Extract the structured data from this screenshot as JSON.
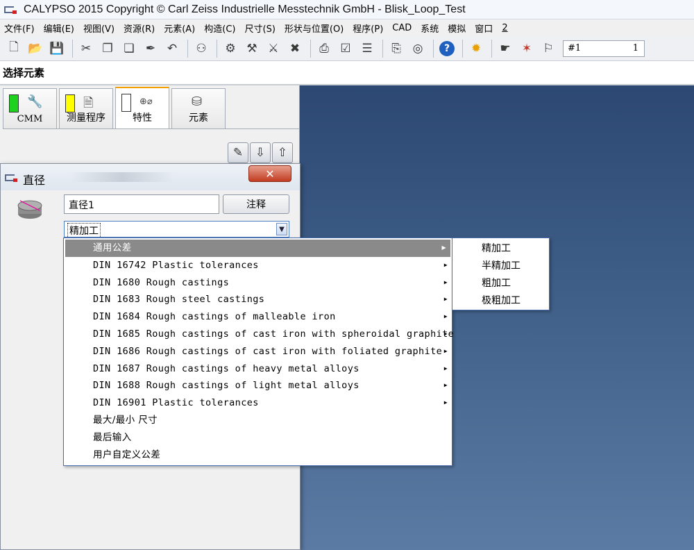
{
  "window": {
    "title": "CALYPSO 2015 Copyright © Carl Zeiss Industrielle Messtechnik GmbH - Blisk_Loop_Test"
  },
  "menu": [
    "文件(F)",
    "编辑(E)",
    "视图(V)",
    "资源(R)",
    "元素(A)",
    "构造(C)",
    "尺寸(S)",
    "形状与位置(O)",
    "程序(P)",
    "CAD",
    "系统",
    "模拟",
    "窗口",
    "2"
  ],
  "toolbar": {
    "icons": [
      "new-file-icon",
      "open-folder-icon",
      "save-icon",
      "cut-icon",
      "copy-icon",
      "paste-icon",
      "brush-icon",
      "undo-icon",
      "binoculars-icon",
      "probe-icon",
      "probe-2-icon",
      "tools-icon",
      "wrench-icon",
      "print-icon",
      "trash-icon",
      "document-icon",
      "clipboard-icon",
      "dial-icon",
      "help-icon",
      "sun-icon",
      "hand-icon",
      "star-icon",
      "run-icon"
    ],
    "field_label": "#1",
    "field_value": "1"
  },
  "section": {
    "title": "选择元素"
  },
  "tabs": [
    {
      "label": "CMM",
      "status_color": "#1fd11f",
      "icon": "wrench-icon"
    },
    {
      "label": "测量程序",
      "status_color": "#ffff00",
      "icon": "document-icon"
    },
    {
      "label": "特性",
      "status_color": "#ffffff",
      "icon": "characteristic-icon"
    },
    {
      "label": "元素",
      "status_color": "",
      "icon": "cylinder-icon"
    }
  ],
  "dialog": {
    "title": "直径",
    "name_value": "直径1",
    "note_button": "注释",
    "tolerance_selected": "精加工"
  },
  "dropdown": {
    "items": [
      {
        "label": "通用公差",
        "has_submenu": true,
        "highlighted": true
      },
      {
        "label": "DIN 16742 Plastic tolerances",
        "has_submenu": true
      },
      {
        "label": "DIN 1680 Rough castings",
        "has_submenu": true
      },
      {
        "label": "DIN 1683 Rough steel castings",
        "has_submenu": true
      },
      {
        "label": "DIN 1684 Rough castings of malleable iron",
        "has_submenu": true
      },
      {
        "label": "DIN 1685 Rough castings of cast iron with spheroidal graphite",
        "has_submenu": true
      },
      {
        "label": "DIN 1686 Rough castings of cast iron with foliated graphite",
        "has_submenu": true
      },
      {
        "label": "DIN 1687 Rough castings of heavy metal alloys",
        "has_submenu": true
      },
      {
        "label": "DIN 1688 Rough castings of light metal alloys",
        "has_submenu": true
      },
      {
        "label": "DIN 16901 Plastic tolerances",
        "has_submenu": true
      },
      {
        "label": "最大/最小 尺寸",
        "has_submenu": false
      },
      {
        "label": "最后输入",
        "has_submenu": false
      },
      {
        "label": "用户自定义公差",
        "has_submenu": false
      }
    ]
  },
  "submenu": {
    "items": [
      "精加工",
      "半精加工",
      "粗加工",
      "极粗加工"
    ]
  },
  "colors": {
    "accent": "#f2a000",
    "highlight": "#8a8a8a",
    "viewport_top": "#2c4873",
    "viewport_bottom": "#5b7ba4",
    "close_button": "#c23b20"
  }
}
